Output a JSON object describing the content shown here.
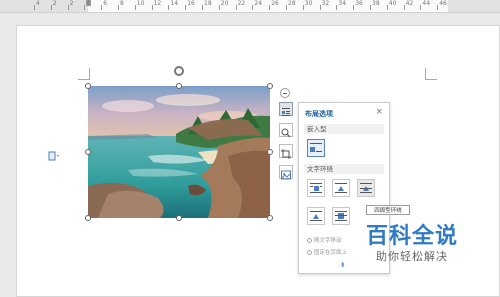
{
  "ruler": {
    "labels": [
      "4",
      "2",
      "2",
      "4",
      "6",
      "8",
      "10",
      "12",
      "14",
      "16",
      "18",
      "20",
      "22",
      "24",
      "26",
      "28",
      "30",
      "32",
      "34",
      "36",
      "38",
      "40",
      "42",
      "44",
      "46"
    ]
  },
  "layout_panel": {
    "title": "布局选项",
    "close_symbol": "×",
    "section_inline": "嵌入型",
    "section_wrap": "文字环绕",
    "option_move_with_text": "随文字移动",
    "option_fix_on_page": "固定在页面上",
    "expand_symbol": "⇟"
  },
  "tooltip": {
    "text": "四周型环绕"
  },
  "watermark": {
    "title": "百科全说",
    "subtitle": "助你轻松解决"
  },
  "icons": {
    "side_tools": [
      "layout-options-icon",
      "zoom-icon",
      "crop-icon",
      "picture-effects-icon"
    ],
    "collapse": "minus-circle-icon",
    "rotate": "rotate-handle-icon",
    "document": "document-icon"
  }
}
